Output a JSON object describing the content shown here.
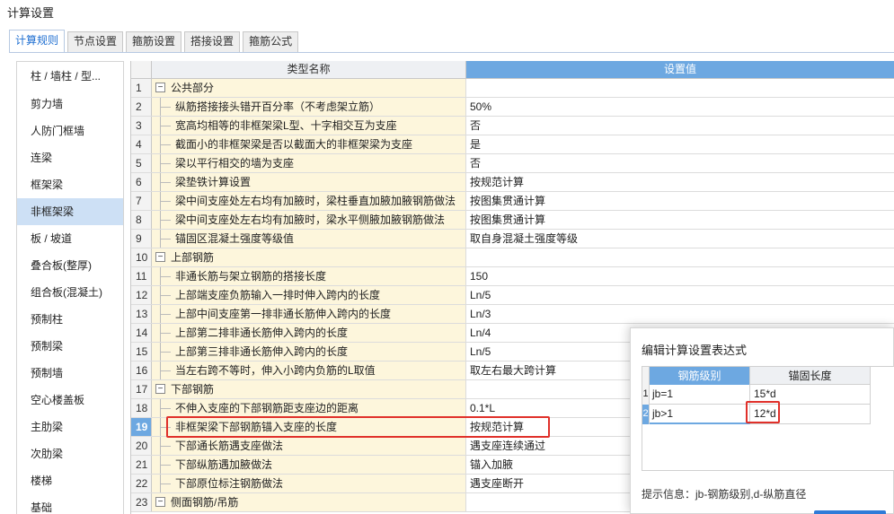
{
  "window": {
    "title": "计算设置"
  },
  "tabs": [
    {
      "label": "计算规则",
      "active": true
    },
    {
      "label": "节点设置",
      "active": false
    },
    {
      "label": "箍筋设置",
      "active": false
    },
    {
      "label": "搭接设置",
      "active": false
    },
    {
      "label": "箍筋公式",
      "active": false
    }
  ],
  "sidebar": {
    "items": [
      "柱 / 墙柱 / 型...",
      "剪力墙",
      "人防门框墙",
      "连梁",
      "框架梁",
      "非框架梁",
      "板 / 坡道",
      "叠合板(整厚)",
      "组合板(混凝土)",
      "预制柱",
      "预制梁",
      "预制墙",
      "空心楼盖板",
      "主肋梁",
      "次肋梁",
      "楼梯",
      "基础"
    ],
    "selected_index": 5
  },
  "grid": {
    "header": {
      "name": "类型名称",
      "value": "设置值"
    },
    "current_row": "19",
    "rows": [
      {
        "num": "1",
        "type": "group",
        "name": "公共部分",
        "value": ""
      },
      {
        "num": "2",
        "type": "child",
        "name": "纵筋搭接接头错开百分率（不考虑架立筋）",
        "value": "50%"
      },
      {
        "num": "3",
        "type": "child",
        "name": "宽高均相等的非框架梁L型、十字相交互为支座",
        "value": "否"
      },
      {
        "num": "4",
        "type": "child",
        "name": "截面小的非框架梁是否以截面大的非框架梁为支座",
        "value": "是"
      },
      {
        "num": "5",
        "type": "child",
        "name": "梁以平行相交的墙为支座",
        "value": "否"
      },
      {
        "num": "6",
        "type": "child",
        "name": "梁垫铁计算设置",
        "value": "按规范计算"
      },
      {
        "num": "7",
        "type": "child",
        "name": "梁中间支座处左右均有加腋时，梁柱垂直加腋加腋钢筋做法",
        "value": "按图集贯通计算"
      },
      {
        "num": "8",
        "type": "child",
        "name": "梁中间支座处左右均有加腋时，梁水平侧腋加腋钢筋做法",
        "value": "按图集贯通计算"
      },
      {
        "num": "9",
        "type": "child",
        "name": "锚固区混凝土强度等级值",
        "value": "取自身混凝土强度等级"
      },
      {
        "num": "10",
        "type": "group",
        "name": "上部钢筋",
        "value": ""
      },
      {
        "num": "11",
        "type": "child",
        "name": "非通长筋与架立钢筋的搭接长度",
        "value": "150"
      },
      {
        "num": "12",
        "type": "child",
        "name": "上部端支座负筋输入一排时伸入跨内的长度",
        "value": "Ln/5"
      },
      {
        "num": "13",
        "type": "child",
        "name": "上部中间支座第一排非通长筋伸入跨内的长度",
        "value": "Ln/3"
      },
      {
        "num": "14",
        "type": "child",
        "name": "上部第二排非通长筋伸入跨内的长度",
        "value": "Ln/4"
      },
      {
        "num": "15",
        "type": "child",
        "name": "上部第三排非通长筋伸入跨内的长度",
        "value": "Ln/5"
      },
      {
        "num": "16",
        "type": "child",
        "name": "当左右跨不等时，伸入小跨内负筋的L取值",
        "value": "取左右最大跨计算"
      },
      {
        "num": "17",
        "type": "group",
        "name": "下部钢筋",
        "value": ""
      },
      {
        "num": "18",
        "type": "child",
        "name": "不伸入支座的下部钢筋距支座边的距离",
        "value": "0.1*L"
      },
      {
        "num": "19",
        "type": "child",
        "name": "非框架梁下部钢筋锚入支座的长度",
        "value": "按规范计算"
      },
      {
        "num": "20",
        "type": "child",
        "name": "下部通长筋遇支座做法",
        "value": "遇支座连续通过"
      },
      {
        "num": "21",
        "type": "child",
        "name": "下部纵筋遇加腋做法",
        "value": "锚入加腋"
      },
      {
        "num": "22",
        "type": "child",
        "name": "下部原位标注钢筋做法",
        "value": "遇支座断开"
      },
      {
        "num": "23",
        "type": "group",
        "name": "侧面钢筋/吊筋",
        "value": ""
      }
    ]
  },
  "dialog": {
    "title": "编辑计算设置表达式",
    "headers": [
      "钢筋级别",
      "锚固长度"
    ],
    "rows": [
      {
        "num": "1",
        "grade": "jb=1",
        "length": "15*d"
      },
      {
        "num": "2",
        "grade": "jb>1",
        "length": "12*d"
      }
    ],
    "hint": "提示信息：jb-钢筋级别,d-纵筋直径"
  },
  "colors": {
    "accent": "#6da8e1",
    "highlight": "#e0302a",
    "name_cell": "#fdf6dc",
    "sidebar_selected": "#cde0f5"
  }
}
